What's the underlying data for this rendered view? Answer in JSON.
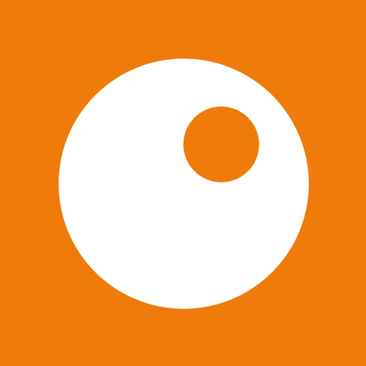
{
  "icon": {
    "name": "orange-circle-logo-icon",
    "background_color": "#EE7B0A",
    "outer_circle_color": "#FFFFFF",
    "inner_dot_color": "#EE7B0A"
  }
}
